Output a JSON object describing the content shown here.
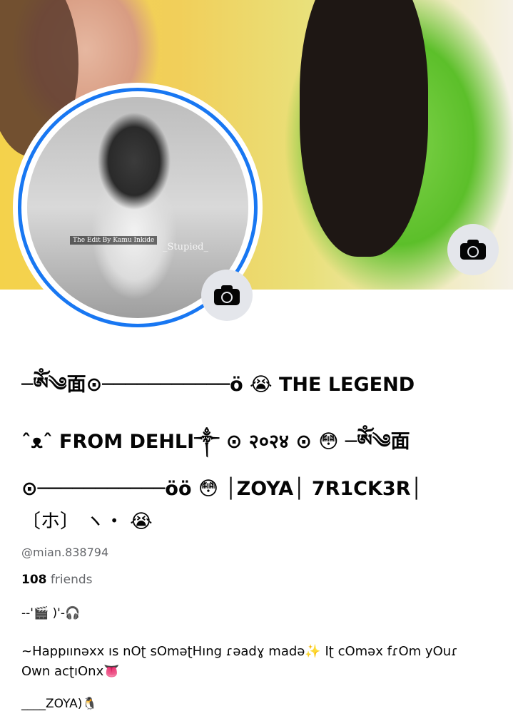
{
  "cover": {
    "description": "cover photo",
    "camera_icon": "camera-icon"
  },
  "avatar": {
    "ring_color": "#1877f2",
    "caption": "The Edit By Kamu Inkide",
    "tag": "_Stupied_",
    "camera_icon": "camera-icon"
  },
  "profile": {
    "name_line1": "─ༀ༄面⊙───────────ö 😭 THE  LEGEND",
    "name_line2": "ˆᴥˆ FROM DEHLI༒ ⊙ २०२४ ⊙ 😳 ─ༀ༄面",
    "name_line3": "⊙───────────öö 😳  │ZOYA│ 7R1CK3R│",
    "name_line4": "〔ホ〕 ヽ・  😭",
    "username": "@mian.838794",
    "friends_count": "108",
    "friends_label": "friends"
  },
  "bio": {
    "line1": "--'🎬 )'-🎧",
    "line2": "~Happıınəxx ıs nΟʈ sΟməʈHıng ɾəadɣ madə✨ Iʈ cΟməx fɾΟm yΟuɾ Οwn acʈıΟnx👅",
    "line3": "____ZOYA)🐧"
  },
  "colors": {
    "accent": "#1877f2",
    "secondary_text": "#65676b",
    "button_bg": "#e4e6eb"
  }
}
